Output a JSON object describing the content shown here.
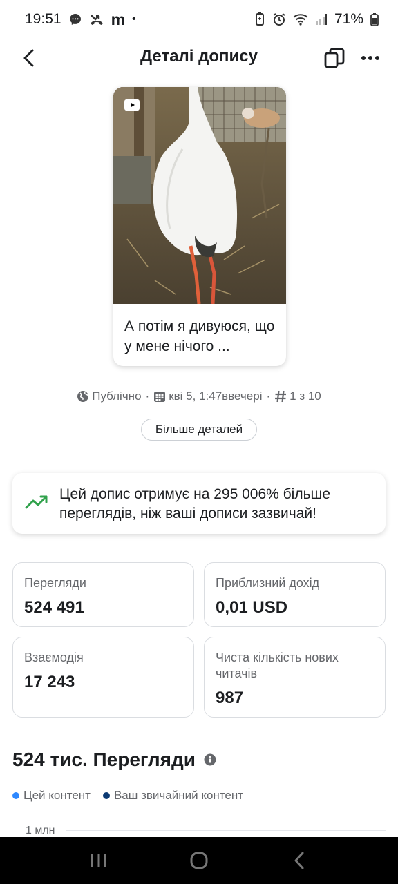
{
  "status_bar": {
    "time": "19:51",
    "app_letter": "m",
    "dot": "•",
    "battery": "71%",
    "icons": [
      "messenger-icon",
      "missed-call-icon",
      "battery-saver-icon",
      "alarm-icon",
      "wifi-icon",
      "signal-icon",
      "battery-icon"
    ]
  },
  "header": {
    "title": "Деталі допису",
    "icons": [
      "back-arrow-icon",
      "copy-icon",
      "more-icon"
    ]
  },
  "post": {
    "caption": "А потім я дивуюся, що у мене нічого ...",
    "has_video_icon": true
  },
  "meta": {
    "visibility": "Публічно",
    "separator": "·",
    "date": "кві 5, 1:47ввечері",
    "position": "1 з 10"
  },
  "more_details_label": "Більше деталей",
  "insight": {
    "text": "Цей допис отримує на 295 006% більше переглядів, ніж ваші дописи зазвичай!",
    "accent_color": "#31a24c"
  },
  "stats": [
    {
      "label": "Перегляди",
      "value": "524 491"
    },
    {
      "label": "Приблизний дохід",
      "value": "0,01 USD"
    },
    {
      "label": "Взаємодія",
      "value": "17 243"
    },
    {
      "label": "Чиста кількість нових читачів",
      "value": "987"
    }
  ],
  "views_section": {
    "title": "524 тис. Перегляди",
    "legend": [
      {
        "label": "Цей контент",
        "color": "#2d88ff"
      },
      {
        "label": "Ваш звичайний контент",
        "color": "#0b3a73"
      }
    ],
    "axis_top_label": "1 млн"
  }
}
